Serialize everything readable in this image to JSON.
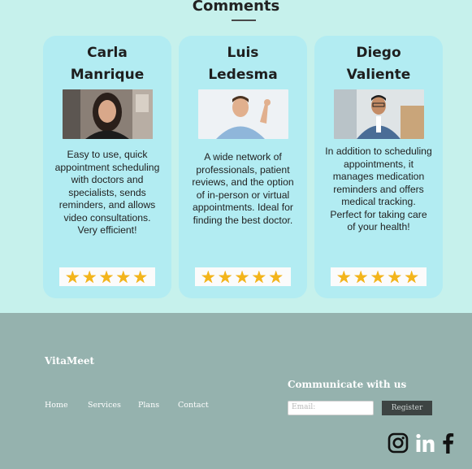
{
  "section": {
    "title": "Comments"
  },
  "testimonials": [
    {
      "name_line1": "Carla",
      "name_line2": "Manrique",
      "text": "Easy to use, quick appointment scheduling with doctors and specialists, sends reminders, and allows video consultations. Very efficient!",
      "rating": 5,
      "rating_text": "★★★★★"
    },
    {
      "name_line1": "Luis",
      "name_line2": "Ledesma",
      "text": "A wide network of professionals, patient reviews, and the option of in-person or virtual appointments. Ideal for finding the best doctor.",
      "rating": 5,
      "rating_text": "★★★★★"
    },
    {
      "name_line1": "Diego",
      "name_line2": "Valiente",
      "text": "In addition to scheduling appointments, it manages medication reminders and offers medical tracking. Perfect for taking care of your health!",
      "rating": 5,
      "rating_text": "★★★★★"
    }
  ],
  "footer": {
    "brand": "VitaMeet",
    "nav": [
      "Home",
      "Services",
      "Plans",
      "Contact"
    ],
    "communicate_title": "Communicate with us",
    "email_placeholder": "Email:",
    "register_label": "Register",
    "social_icons": [
      "instagram-icon",
      "linkedin-icon",
      "facebook-icon"
    ]
  },
  "colors": {
    "top_background": "#c6f1ec",
    "card_background": "#b2ecf2",
    "footer_background": "#95b2ae",
    "star": "#f3b51b"
  }
}
